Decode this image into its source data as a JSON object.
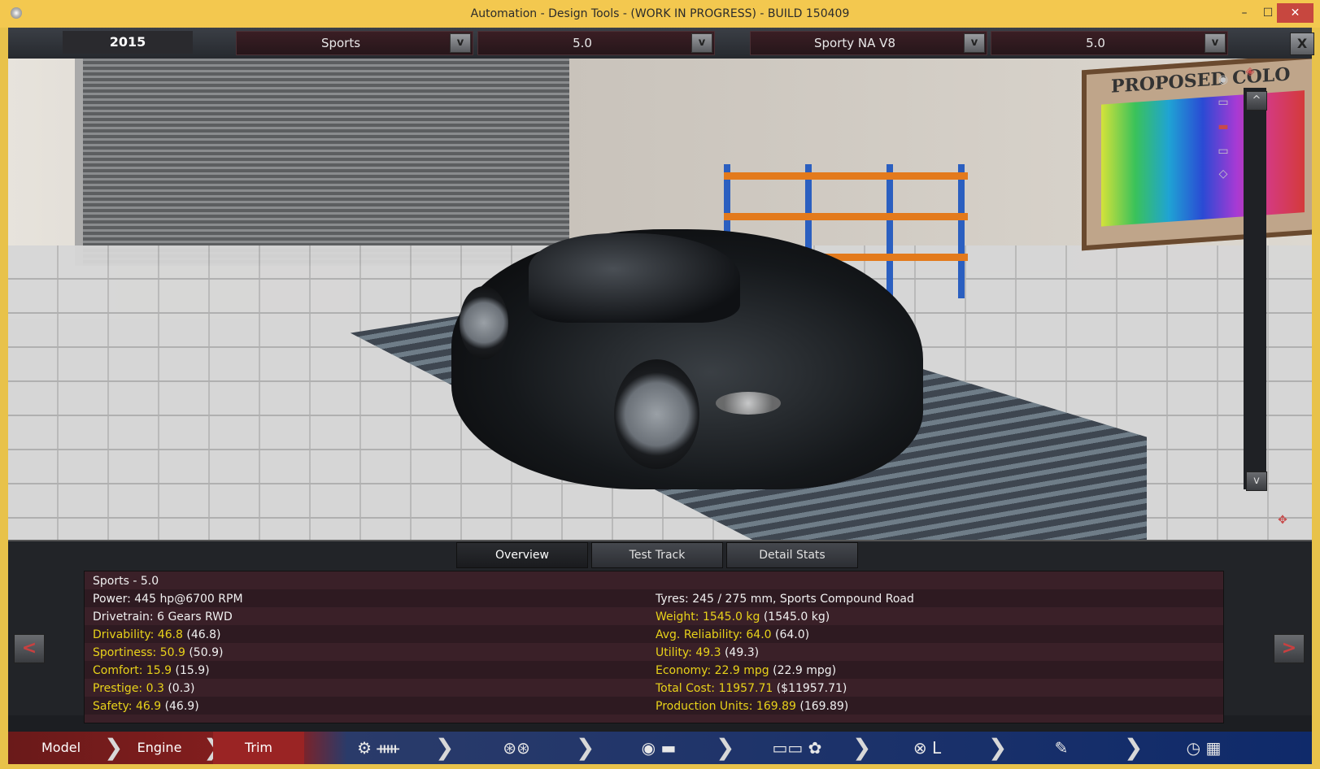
{
  "window": {
    "title": "Automation - Design Tools - (WORK IN PROGRESS) - BUILD 150409",
    "min": "–",
    "max": "☐",
    "close": "✕"
  },
  "topbar": {
    "year": "2015",
    "model_family": "Sports",
    "model_variant": "5.0",
    "engine_family": "Sporty NA V8",
    "engine_variant": "5.0",
    "dropdown_button": "v",
    "close_button": "X"
  },
  "scene": {
    "board_title": "PROPOSED COLO"
  },
  "viewport_controls": {
    "scroll_up": "^",
    "scroll_down": "v"
  },
  "tabs": [
    "Overview",
    "Test Track",
    "Detail Stats"
  ],
  "stats": {
    "left": [
      {
        "label": "Sports - 5.0",
        "value": "",
        "extra": ""
      },
      {
        "label": "Power:",
        "value": "445 hp@6700 RPM",
        "extra": ""
      },
      {
        "label": "Drivetrain:",
        "value": "6 Gears RWD",
        "extra": ""
      },
      {
        "label": "Drivability:",
        "value": "46.8",
        "extra": "(46.8)"
      },
      {
        "label": "Sportiness:",
        "value": "50.9",
        "extra": "(50.9)"
      },
      {
        "label": "Comfort:",
        "value": "15.9",
        "extra": "(15.9)"
      },
      {
        "label": "Prestige:",
        "value": "0.3",
        "extra": "(0.3)"
      },
      {
        "label": "Safety:",
        "value": "46.9",
        "extra": "(46.9)"
      }
    ],
    "right": [
      {
        "label": "Tyres:",
        "value": "245 / 275 mm, Sports Compound Road",
        "extra": ""
      },
      {
        "label": "Weight:",
        "value": "1545.0 kg",
        "extra": "(1545.0 kg)"
      },
      {
        "label": "Avg. Reliability:",
        "value": "64.0",
        "extra": "(64.0)"
      },
      {
        "label": "Utility:",
        "value": "49.3",
        "extra": "(49.3)"
      },
      {
        "label": "Economy:",
        "value": "22.9 mpg",
        "extra": "(22.9 mpg)"
      },
      {
        "label": "Total Cost:",
        "value": "11957.71",
        "extra": "($11957.71)"
      },
      {
        "label": "Production Units:",
        "value": "169.89",
        "extra": "(169.89)"
      }
    ]
  },
  "nav": {
    "prev": "<",
    "next": ">"
  },
  "bottombar": {
    "model": "Model",
    "engine": "Engine",
    "trim": "Trim",
    "chevron": "❯"
  },
  "icons": {
    "gearbox": "gearbox-icon",
    "wheels": "wheels-icon",
    "body": "body-fixture-icon",
    "aero": "aero-icon",
    "interior": "interior-icon",
    "tuning": "tuning-icon",
    "test": "test-track-icon"
  },
  "colors": {
    "titlebar": "#f3c84f",
    "highlight_text": "#e8d21a",
    "trim_active": "#8a1f1f"
  }
}
